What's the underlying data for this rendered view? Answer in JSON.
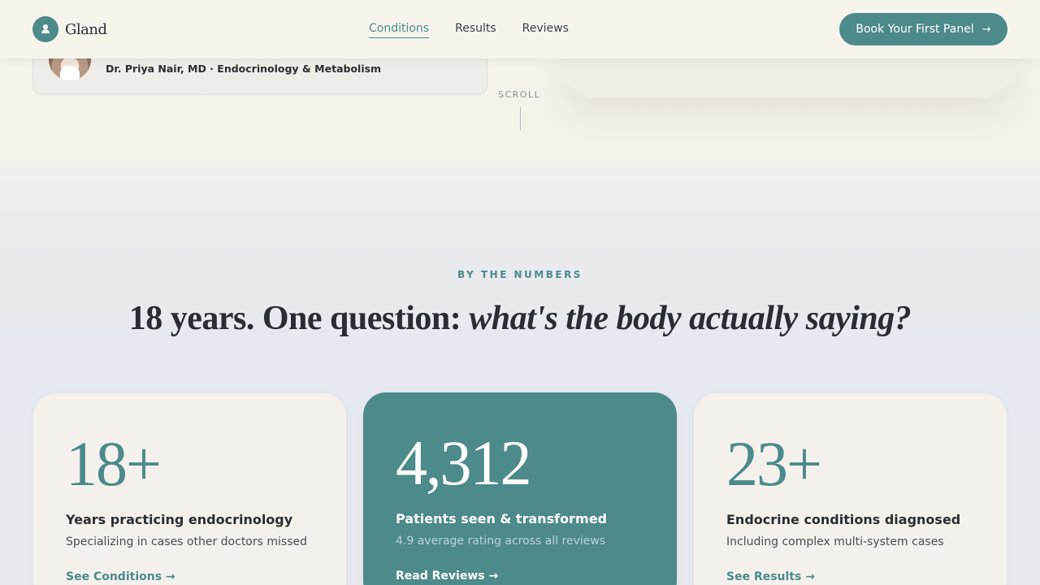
{
  "header": {
    "logo_text": "Gland",
    "nav": [
      {
        "label": "Conditions",
        "active": true
      },
      {
        "label": "Results",
        "active": false
      },
      {
        "label": "Reviews",
        "active": false
      }
    ],
    "cta_label": "Book Your First Panel",
    "cta_arrow": "→"
  },
  "hero": {
    "doctor_name": "Dr. Priya Nair, MD · Endocrinology & Metabolism",
    "scroll_label": "SCROLL"
  },
  "numbers": {
    "eyebrow": "BY THE NUMBERS",
    "headline_plain": "18 years. One question: ",
    "headline_italic": "what's the body actually saying?",
    "cards": [
      {
        "stat": "18+",
        "title": "Years practicing endocrinology",
        "desc": "Specializing in cases other doctors missed",
        "link": "See Conditions →"
      },
      {
        "stat": "4,312",
        "title": "Patients seen & transformed",
        "desc": "4.9 average rating across all reviews",
        "link": "Read Reviews →"
      },
      {
        "stat": "23+",
        "title": "Endocrine conditions diagnosed",
        "desc": "Including complex multi-system cases",
        "link": "See Results →"
      }
    ]
  },
  "colors": {
    "accent": "#4d8a8a",
    "card_bg": "#f4f1ec",
    "text": "#2a2d33"
  }
}
